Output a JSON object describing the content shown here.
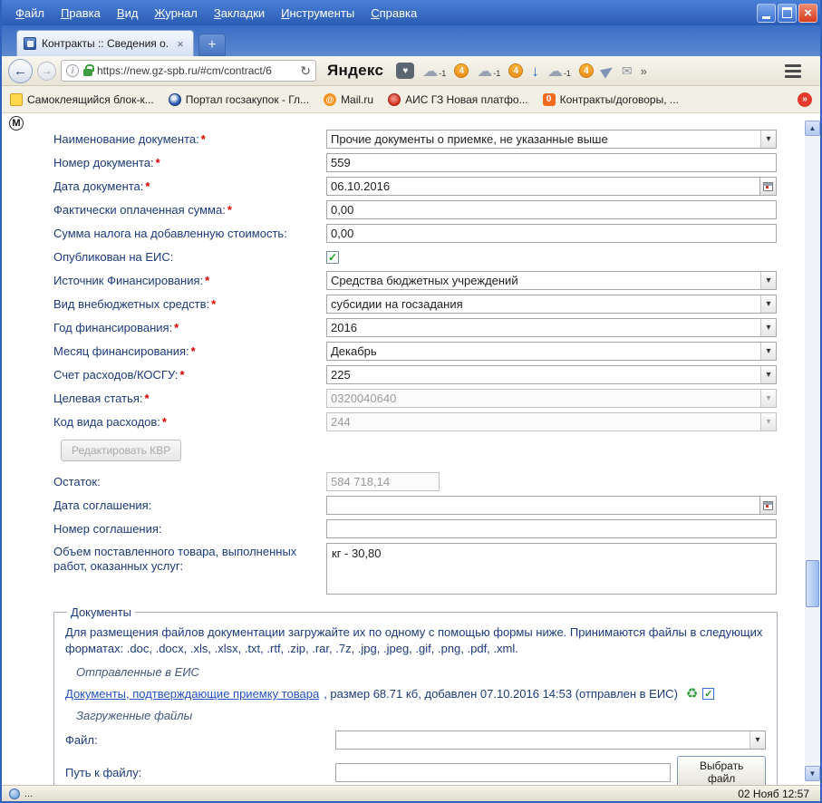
{
  "menu": [
    "Файл",
    "Правка",
    "Вид",
    "Журнал",
    "Закладки",
    "Инструменты",
    "Справка"
  ],
  "tab": {
    "title": "Контракты :: Сведения о..."
  },
  "nav": {
    "url": "https://new.gz-spb.ru/#cm/contract/6",
    "yandex": "Яндекс",
    "cloud_badge": "-1",
    "count_badge": "4"
  },
  "bookmarks": {
    "items": [
      "Самоклеящийся блок-к...",
      "Портал госзакупок - Гл...",
      "Mail.ru",
      "АИС ГЗ Новая платфо...",
      "Контракты/договоры, ..."
    ],
    "m_badge": "М"
  },
  "form": {
    "fields": [
      {
        "label": "Наименование документа:",
        "req": "*",
        "value": "Прочие документы о приемке, не указанные выше"
      },
      {
        "label": "Номер документа:",
        "req": "*",
        "value": "559"
      },
      {
        "label": "Дата документа:",
        "req": "*",
        "value": "06.10.2016"
      },
      {
        "label": "Фактически оплаченная сумма:",
        "req": "*",
        "value": "0,00"
      },
      {
        "label": "Сумма налога на добавленную стоимость:",
        "req": "",
        "value": "0,00"
      },
      {
        "label": "Опубликован на ЕИС:",
        "req": "",
        "value": "checked"
      },
      {
        "label": "Источник Финансирования:",
        "req": "*",
        "value": "Средства бюджетных учреждений"
      },
      {
        "label": "Вид внебюджетных средств:",
        "req": "*",
        "value": "субсидии на госзадания"
      },
      {
        "label": "Год финансирования:",
        "req": "*",
        "value": "2016"
      },
      {
        "label": "Месяц финансирования:",
        "req": "*",
        "value": "Декабрь"
      },
      {
        "label": "Счет расходов/КОСГУ:",
        "req": "*",
        "value": "225"
      },
      {
        "label": "Целевая статья:",
        "req": "*",
        "value": "0320040640"
      },
      {
        "label": "Код вида расходов:",
        "req": "*",
        "value": "244"
      }
    ],
    "kvr_button": "Редактировать КВР",
    "rest_label": "Остаток:",
    "rest_value": "584 718,14",
    "agr_date_label": "Дата соглашения:",
    "agr_num_label": "Номер соглашения:",
    "volume_label": "Объем поставленного товара, выполненных работ, оказанных услуг:",
    "volume_value": "кг - 30,80"
  },
  "documents": {
    "legend": "Документы",
    "intro": "Для размещения файлов документации загружайте их по одному с помощью формы ниже. Принимаются файлы в следующих форматах: .doc, .docx, .xls, .xlsx, .txt, .rtf, .zip, .rar, .7z, .jpg, .jpeg, .gif, .png, .pdf, .xml.",
    "sent_heading": "Отправленные в ЕИС",
    "file_link": "Документы, подтверждающие приемку товара",
    "file_meta": ", размер 68.71 кб, добавлен 07.10.2016 14:53 (отправлен в ЕИС)",
    "uploaded_heading": "Загруженные файлы",
    "file_label": "Файл:",
    "path_label": "Путь к файлу:",
    "choose_button": "Выбрать файл"
  },
  "statusbar": {
    "left": "...",
    "clock": "02 Нояб 12:57"
  }
}
